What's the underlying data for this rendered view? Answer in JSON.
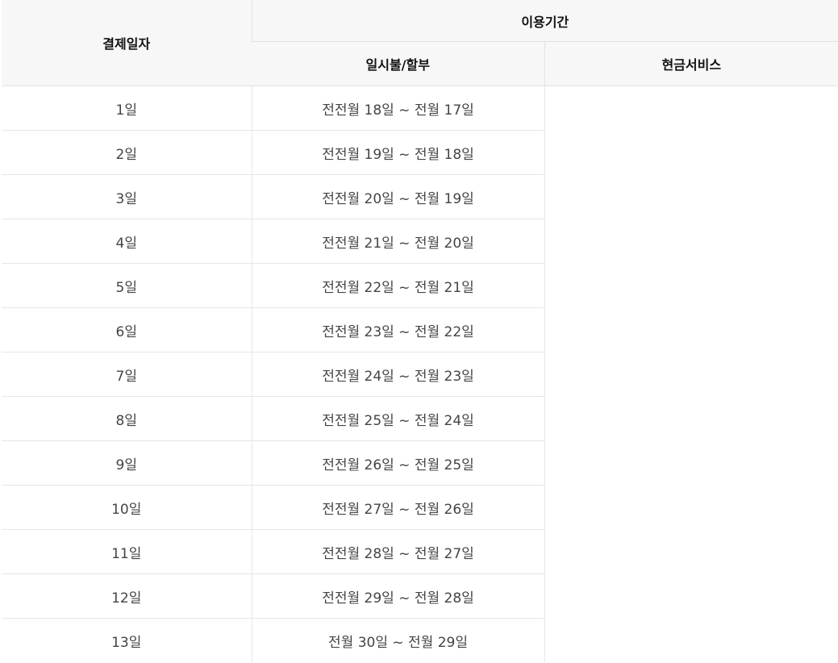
{
  "table": {
    "header": {
      "payment_date": "결제일자",
      "usage_period": "이용기간",
      "lump_installment": "일시불/할부",
      "cash_service": "현금서비스"
    },
    "rows": [
      {
        "day": "1일",
        "period": "전전월 18일 ~ 전월 17일"
      },
      {
        "day": "2일",
        "period": "전전월 19일 ~ 전월 18일"
      },
      {
        "day": "3일",
        "period": "전전월 20일 ~ 전월 19일"
      },
      {
        "day": "4일",
        "period": "전전월 21일 ~ 전월 20일"
      },
      {
        "day": "5일",
        "period": "전전월 22일 ~ 전월 21일"
      },
      {
        "day": "6일",
        "period": "전전월 23일 ~ 전월 22일"
      },
      {
        "day": "7일",
        "period": "전전월 24일 ~ 전월 23일"
      },
      {
        "day": "8일",
        "period": "전전월 25일 ~ 전월 24일"
      },
      {
        "day": "9일",
        "period": "전전월 26일 ~ 전월 25일"
      },
      {
        "day": "10일",
        "period": "전전월 27일 ~ 전월 26일"
      },
      {
        "day": "11일",
        "period": "전전월 28일 ~ 전월 27일"
      },
      {
        "day": "12일",
        "period": "전전월 29일 ~ 전월 28일"
      },
      {
        "day": "13일",
        "period": "전월 30일 ~ 전월 29일"
      }
    ]
  }
}
